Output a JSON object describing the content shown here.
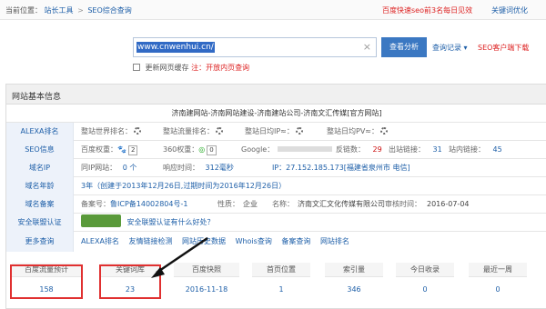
{
  "topbar": {
    "current_label": "当前位置：",
    "crumb1": "站长工具",
    "sep": ">",
    "crumb2": "SEO综合查询",
    "notice": "百度快速seo前3名每日见效",
    "keyword_opt": "关键词优化"
  },
  "search": {
    "value": "www.cnwenhui.cn/",
    "clear_glyph": "×",
    "query_button": "查看分析",
    "history_label": "查询记录 ▾",
    "seo_client": "SEO客户端下载",
    "cache_label": "更新网页缓存",
    "cache_note": "注：开放内页查询"
  },
  "panel": {
    "title": "网站基本信息",
    "site_title": "济南建网站-济南网站建设-济南建站公司-济南文汇传媒[官方网站]"
  },
  "rows": {
    "alexa": {
      "label": "ALEXA排名",
      "world": "整站世界排名：",
      "flow": "整站流量排名：",
      "ip": "整站日均IP≈：",
      "pv": "整站日均PV≈："
    },
    "seo": {
      "label": "SEO信息",
      "baidu_weight": "百度权重：",
      "baidu_weight_value": "2",
      "weight360": "360权重：",
      "weight360_value": "0",
      "google": "Google：",
      "backlinks": "反链数：",
      "backlinks_value": "29",
      "outlinks": "出站链接：",
      "outlinks_value": "31",
      "inlinks": "站内链接：",
      "inlinks_value": "45"
    },
    "ip": {
      "label": "域名IP",
      "same_ip": "同IP网站：",
      "same_ip_value": "0 个",
      "response": "响应时间：",
      "response_value": "312毫秒",
      "ip_text": "IP：27.152.185.173[福建省泉州市 电信]"
    },
    "age": {
      "label": "域名年龄",
      "text": "3年（创建于2013年12月26日,过期时间为2016年12月26日）"
    },
    "icp": {
      "label": "域名备案",
      "num_label": "备案号：",
      "num_value": "鲁ICP备14002804号-1",
      "nature_label": "性质：",
      "nature_value": "企业",
      "name_label": "名称：",
      "name_value": "济南文汇文化传媒有限公司",
      "date_label": "审核时间：",
      "date_value": "2016-07-04"
    },
    "safe": {
      "label": "安全联盟认证",
      "text": "安全联盟认证有什么好处？"
    },
    "more": {
      "label": "更多查询",
      "links": [
        "ALEXA排名",
        "友情链接检测",
        "网站历史数据",
        "Whois查询",
        "备案查询",
        "网站排名"
      ]
    }
  },
  "stats": {
    "headers": [
      "百度流量预计",
      "关键词库",
      "百度快照",
      "首页位置",
      "索引量",
      "今日收录",
      "最近一周"
    ],
    "values": [
      "158",
      "23",
      "2016-11-18",
      "1",
      "346",
      "0",
      "0"
    ]
  },
  "colors": {
    "accent": "#3b78c2",
    "link": "#1e5fa8",
    "highlight": "#e03030"
  }
}
